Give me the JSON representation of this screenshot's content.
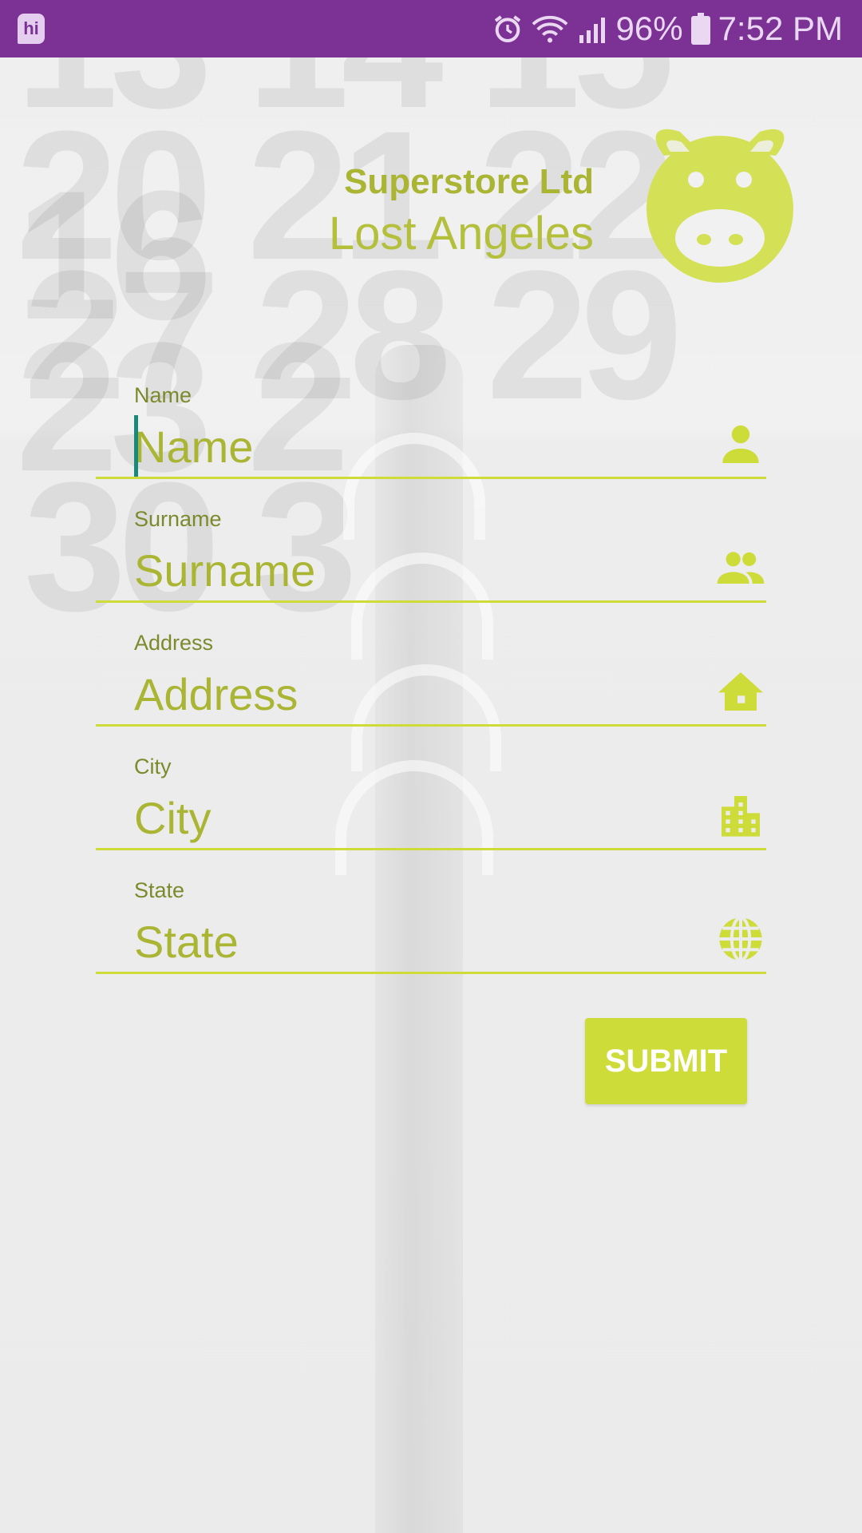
{
  "status_bar": {
    "app_icon_label": "hi",
    "battery_text": "96%",
    "time": "7:52 PM"
  },
  "header": {
    "company": "Superstore Ltd",
    "city": "Lost Angeles"
  },
  "form": {
    "fields": [
      {
        "label": "Name",
        "placeholder": "Name",
        "icon": "person-icon"
      },
      {
        "label": "Surname",
        "placeholder": "Surname",
        "icon": "people-icon"
      },
      {
        "label": "Address",
        "placeholder": "Address",
        "icon": "home-icon"
      },
      {
        "label": "City",
        "placeholder": "City",
        "icon": "city-icon"
      },
      {
        "label": "State",
        "placeholder": "State",
        "icon": "globe-icon"
      }
    ],
    "submit_label": "SUBMIT"
  },
  "colors": {
    "status_bar": "#7b3294",
    "accent": "#cddc39",
    "text_accent": "#aab533",
    "caret": "#18897b"
  }
}
